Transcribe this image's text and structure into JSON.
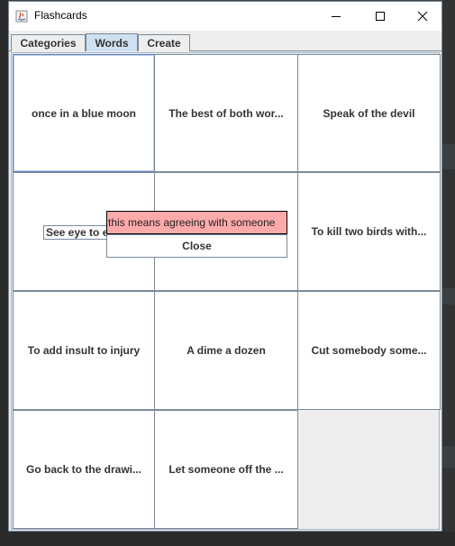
{
  "window": {
    "title": "Flashcards"
  },
  "tabs": [
    {
      "label": "Categories"
    },
    {
      "label": "Words"
    },
    {
      "label": "Create"
    }
  ],
  "cards": [
    "once in a blue moon",
    "The best of both wor...",
    "Speak of the devil",
    "",
    "",
    "To kill two birds with...",
    "To add insult to injury",
    "A dime a dozen",
    "Cut somebody some...",
    "Go back to the drawi...",
    "Let someone off the ..."
  ],
  "popup": {
    "word_field": "See eye to eye",
    "definition": "this means agreeing with someone",
    "close_label": "Close"
  },
  "colors": {
    "definition_bg": "#ffaaaa",
    "selected_tab": "#cfe0f0"
  }
}
